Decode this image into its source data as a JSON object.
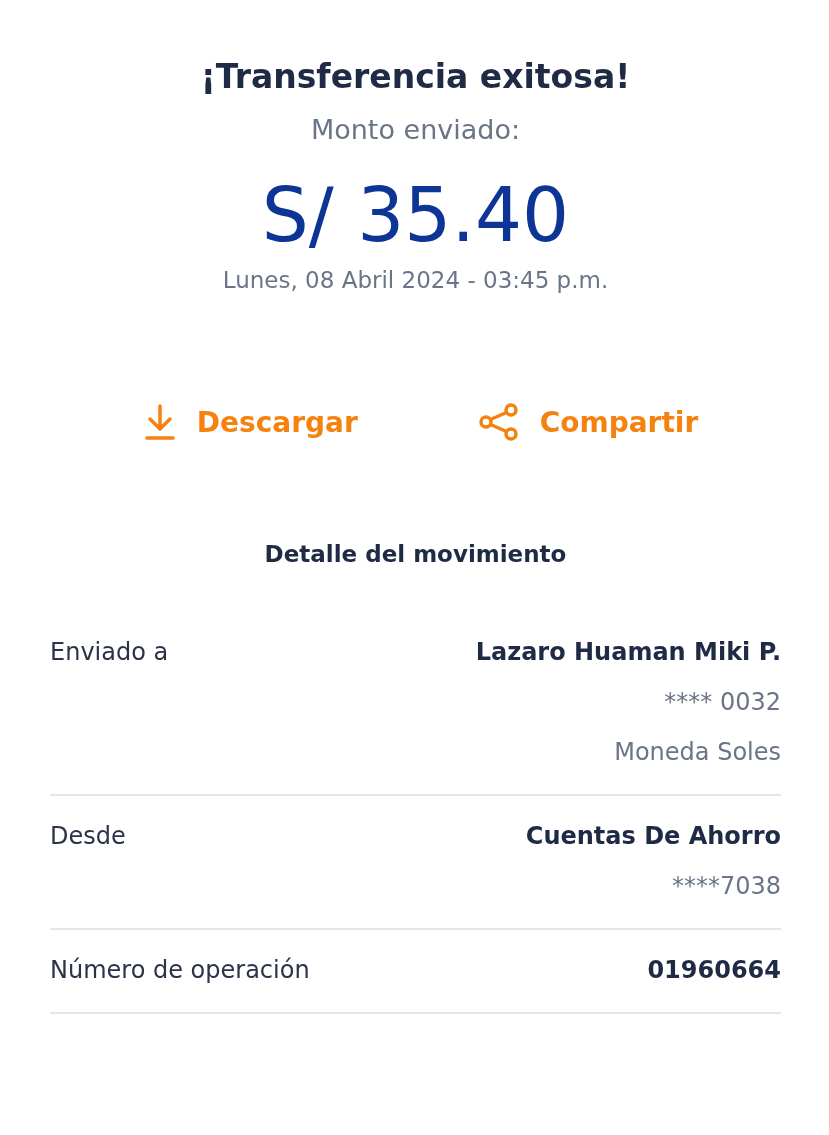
{
  "header": {
    "title": "¡Transferencia exitosa!",
    "amount_label": "Monto enviado:",
    "amount": "S/ 35.40",
    "datetime": "Lunes, 08 Abril 2024 - 03:45 p.m."
  },
  "actions": [
    {
      "kind": "download",
      "label": "Descargar"
    },
    {
      "kind": "share",
      "label": "Compartir"
    }
  ],
  "details": {
    "title": "Detalle del movimiento",
    "rows": [
      {
        "label": "Enviado a",
        "values": [
          "Lazaro Huaman Miki P.",
          "**** 0032",
          "Moneda Soles"
        ]
      },
      {
        "label": "Desde",
        "values": [
          "Cuentas De Ahorro",
          "****7038"
        ]
      },
      {
        "label": "Número de operación",
        "values": [
          "01960664"
        ]
      }
    ]
  }
}
